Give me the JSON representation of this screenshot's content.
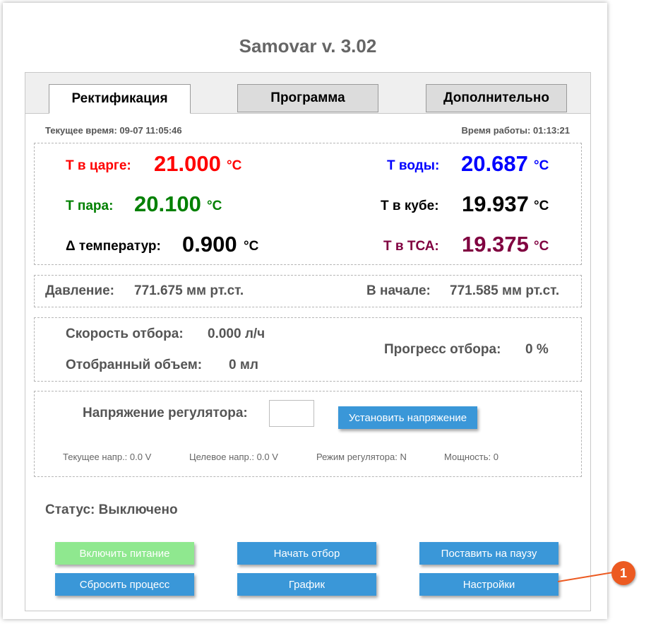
{
  "app": {
    "title": "Samovar v. 3.02"
  },
  "tabs": [
    {
      "label": "Ректификация",
      "active": true
    },
    {
      "label": "Программа",
      "active": false
    },
    {
      "label": "Дополнительно",
      "active": false
    }
  ],
  "time": {
    "current": "Текущее время: 09-07 11:05:46",
    "uptime": "Время работы: 01:13:21"
  },
  "temps": {
    "unit": "°C",
    "column": {
      "label": "Т в царге:",
      "value": "21.000",
      "color": "#ff0000"
    },
    "steam": {
      "label": "Т пара:",
      "value": "20.100",
      "color": "#008000"
    },
    "delta": {
      "label": "Δ температур:",
      "value": "0.900",
      "color": "#000000"
    },
    "water": {
      "label": "Т воды:",
      "value": "20.687",
      "color": "#0000ff"
    },
    "tank": {
      "label": "Т в кубе:",
      "value": "19.937",
      "color": "#000000"
    },
    "tsa": {
      "label": "Т в ТСА:",
      "value": "19.375",
      "color": "#800040"
    }
  },
  "pressure": {
    "label": "Давление:",
    "value": "771.675 мм рт.ст.",
    "start_label": "В начале:",
    "start_value": "771.585 мм рт.ст."
  },
  "withdrawal": {
    "speed_label": "Скорость отбора:",
    "speed_value": "0.000 л/ч",
    "volume_label": "Отобранный объем:",
    "volume_value": "0 мл",
    "progress_label": "Прогресс отбора:",
    "progress_value": "0 %"
  },
  "regulator": {
    "voltage_label": "Напряжение регулятора:",
    "voltage_input_value": "",
    "set_button": "Установить напряжение",
    "current_voltage": "Текущее напр.: 0.0 V",
    "target_voltage": "Целевое напр.: 0.0 V",
    "mode": "Режим регулятора: N",
    "power": "Мощность: 0"
  },
  "status": {
    "text": "Статус: Выключено"
  },
  "buttons": {
    "power_on": "Включить питание",
    "start": "Начать отбор",
    "pause": "Поставить на паузу",
    "reset": "Сбросить процесс",
    "chart": "График",
    "settings": "Настройки"
  },
  "callout": {
    "number": "1",
    "color": "#ec5a21"
  }
}
